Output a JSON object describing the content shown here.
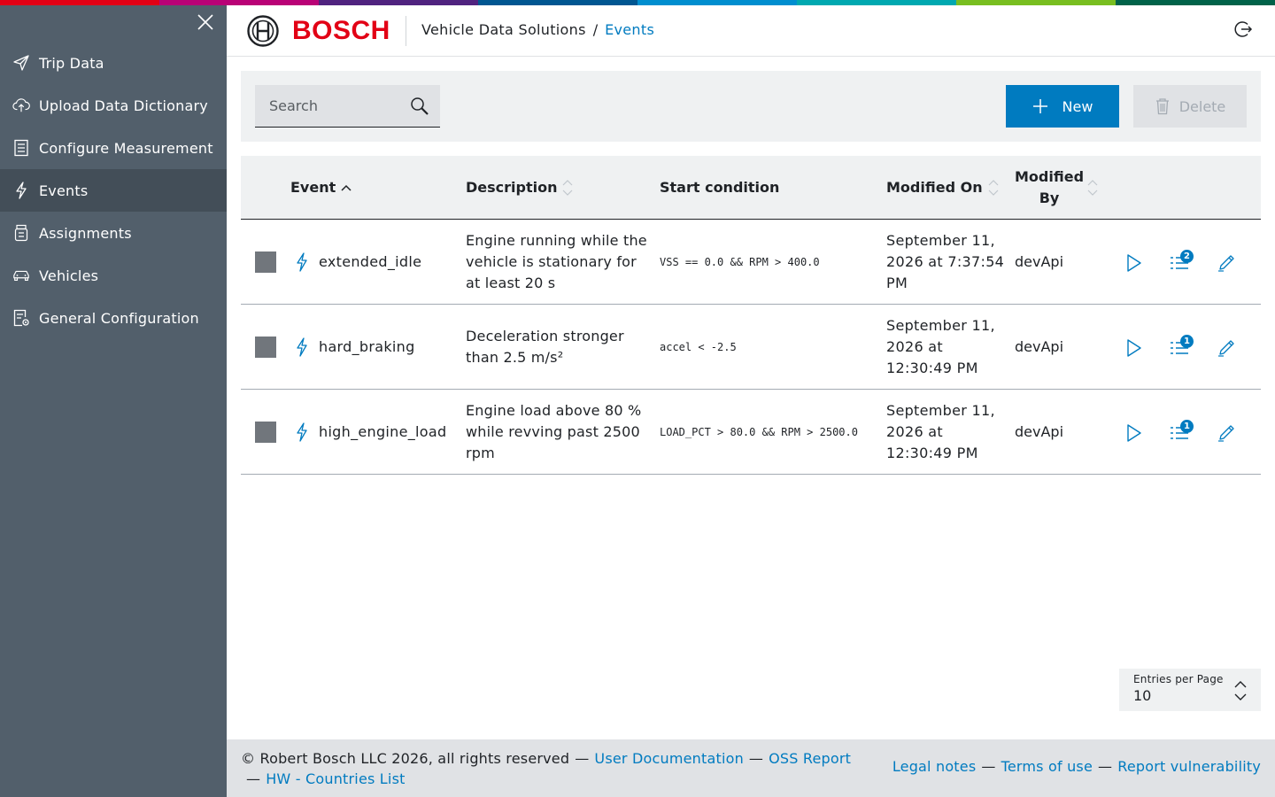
{
  "brand": {
    "name": "BOSCH",
    "colors": {
      "red": "#e20015",
      "blue": "#007bc0",
      "sidebar": "#525f6b",
      "sidebar_active": "#434e58"
    },
    "supergraphic": [
      "#e20015",
      "#b90276",
      "#50237f",
      "#005691",
      "#008ecf",
      "#00a8b0",
      "#78be20",
      "#006249"
    ]
  },
  "sidebar": {
    "close_icon": "close-icon",
    "items": [
      {
        "label": "Trip Data",
        "icon": "send-icon",
        "active": false
      },
      {
        "label": "Upload Data Dictionary",
        "icon": "cloud-upload-icon",
        "active": false
      },
      {
        "label": "Configure Measurement",
        "icon": "document-list-icon",
        "active": false
      },
      {
        "label": "Events",
        "icon": "lightning-icon",
        "active": true
      },
      {
        "label": "Assignments",
        "icon": "sensor-icon",
        "active": false
      },
      {
        "label": "Vehicles",
        "icon": "car-icon",
        "active": false
      },
      {
        "label": "General Configuration",
        "icon": "document-settings-icon",
        "active": false
      }
    ]
  },
  "header": {
    "breadcrumb": {
      "root": "Vehicle Data Solutions",
      "separator": "/",
      "current": "Events"
    },
    "logout_icon": "logout-icon"
  },
  "toolbar": {
    "search_placeholder": "Search",
    "new_label": "New",
    "delete_label": "Delete"
  },
  "table": {
    "headers": {
      "event": "Event",
      "description": "Description",
      "start_condition": "Start condition",
      "modified_on": "Modified On",
      "modified_by_line1": "Modified",
      "modified_by_line2": "By"
    },
    "rows": [
      {
        "event": "extended_idle",
        "description": "Engine running while the vehicle is stationary for at least 20 s",
        "condition": "VSS == 0.0 && RPM > 400.0",
        "modified_on": "September 11, 2026 at 7:37:54 PM",
        "modified_by": "devApi",
        "assignment_count": "2"
      },
      {
        "event": "hard_braking",
        "description": "Deceleration stronger than 2.5 m/s²",
        "condition": "accel < -2.5",
        "modified_on": "September 11, 2026 at 12:30:49 PM",
        "modified_by": "devApi",
        "assignment_count": "1"
      },
      {
        "event": "high_engine_load",
        "description": "Engine load above 80 % while revving past 2500 rpm",
        "condition": "LOAD_PCT > 80.0 && RPM > 2500.0",
        "modified_on": "September 11, 2026 at 12:30:49 PM",
        "modified_by": "devApi",
        "assignment_count": "1"
      }
    ]
  },
  "pager": {
    "label": "Entries per Page",
    "value": "10"
  },
  "footer": {
    "copyright": "© Robert Bosch LLC 2026, all rights reserved",
    "sep": "—",
    "links_left": [
      "User Documentation",
      "OSS Report",
      "HW - Countries List"
    ],
    "links_right": [
      "Legal notes",
      "Terms of use",
      "Report vulnerability"
    ]
  }
}
